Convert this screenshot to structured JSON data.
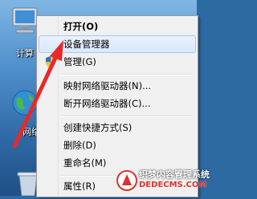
{
  "desktop": {
    "icons": [
      {
        "label": "计算"
      },
      {
        "label": "网络"
      },
      {
        "label": ""
      }
    ]
  },
  "context_menu": {
    "items": [
      {
        "label": "打开(O)",
        "bold": true
      },
      {
        "label": "设备管理器",
        "highlighted": true
      },
      {
        "label": "管理(G)",
        "icon": "uac-shield-icon"
      },
      {
        "label": "映射网络驱动器(N)..."
      },
      {
        "label": "断开网络驱动器(C)..."
      },
      {
        "label": "创建快捷方式(S)"
      },
      {
        "label": "删除(D)"
      },
      {
        "label": "重命名(M)"
      },
      {
        "label": "属性(R)"
      }
    ]
  },
  "annotation": {
    "color": "#e8282a"
  },
  "watermark": {
    "line1": "织梦内容管理系统",
    "line2": "DEDECMS.COM"
  }
}
